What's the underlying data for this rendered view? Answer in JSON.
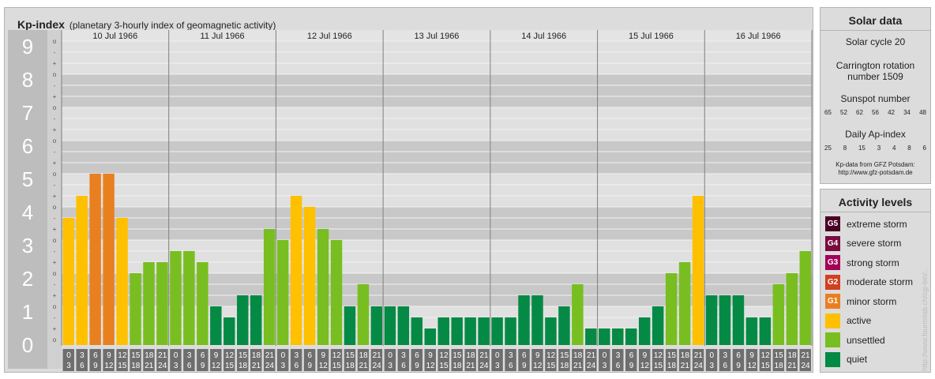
{
  "header": {
    "title": "Kp-index",
    "subtitle": "(planetary 3-hourly index of geomagnetic activity)"
  },
  "chart_data": {
    "type": "bar",
    "title": "Kp-index",
    "subtitle": "(planetary 3-hourly index of geomagnetic activity)",
    "ylim": [
      0,
      9
    ],
    "y_ticks": [
      "0",
      "1",
      "2",
      "3",
      "4",
      "5",
      "6",
      "7",
      "8",
      "9"
    ],
    "y_minor_labels": [
      "o",
      "+",
      "-"
    ],
    "days": [
      "10 Jul 1966",
      "11 Jul 1966",
      "12 Jul 1966",
      "13 Jul 1966",
      "14 Jul 1966",
      "15 Jul 1966",
      "16 Jul 1966"
    ],
    "interval_labels": [
      [
        "0",
        "3"
      ],
      [
        "3",
        "6"
      ],
      [
        "6",
        "9"
      ],
      [
        "9",
        "12"
      ],
      [
        "12",
        "15"
      ],
      [
        "15",
        "18"
      ],
      [
        "18",
        "21"
      ],
      [
        "21",
        "24"
      ]
    ],
    "grid": true,
    "values": [
      3.667,
      4.333,
      5.0,
      5.0,
      3.667,
      2.0,
      2.333,
      2.333,
      2.667,
      2.667,
      2.333,
      1.0,
      0.667,
      1.333,
      1.333,
      3.333,
      3.0,
      4.333,
      4.0,
      3.333,
      3.0,
      1.0,
      1.667,
      1.0,
      1.0,
      1.0,
      0.667,
      0.333,
      0.667,
      0.667,
      0.667,
      0.667,
      0.667,
      0.667,
      1.333,
      1.333,
      0.667,
      1.0,
      1.667,
      0.333,
      0.333,
      0.333,
      0.333,
      0.667,
      1.0,
      2.0,
      2.333,
      4.333,
      1.333,
      1.333,
      1.333,
      0.667,
      0.667,
      1.667,
      2.0,
      2.667
    ],
    "colors": {
      "quiet": "#058a45",
      "unsettled": "#78be21",
      "active": "#ffc000",
      "minor_storm": "#e88020",
      "moderate_storm": "#d14020",
      "strong_storm": "#a30058",
      "severe_storm": "#7a0a40",
      "extreme_storm": "#4a0022"
    }
  },
  "solar": {
    "title": "Solar data",
    "cycle": "Solar cycle 20",
    "carrington_line1": "Carrington rotation",
    "carrington_line2": "number 1509",
    "sunspot_title": "Sunspot number",
    "sunspot_values": [
      "65",
      "52",
      "62",
      "56",
      "42",
      "34",
      "48"
    ],
    "ap_title": "Daily Ap-index",
    "ap_values": [
      "25",
      "8",
      "15",
      "3",
      "4",
      "8",
      "6"
    ],
    "credit_line1": "Kp-data from GFZ Potsdam:",
    "credit_line2": "http://www.gfz-potsdam.de"
  },
  "legend": {
    "title": "Activity levels",
    "items": [
      {
        "badge": "G5",
        "label": "extreme storm",
        "color": "#4a0022"
      },
      {
        "badge": "G4",
        "label": "severe storm",
        "color": "#7a0a40"
      },
      {
        "badge": "G3",
        "label": "strong storm",
        "color": "#a30058"
      },
      {
        "badge": "G2",
        "label": "moderate storm",
        "color": "#d14020"
      },
      {
        "badge": "G1",
        "label": "minor storm",
        "color": "#e88020"
      },
      {
        "badge": "",
        "label": "active",
        "color": "#ffc000"
      },
      {
        "badge": "",
        "label": "unsettled",
        "color": "#78be21"
      },
      {
        "badge": "",
        "label": "quiet",
        "color": "#058a45"
      }
    ]
  },
  "watermark": "http://www.fourmilab.ch/cgi-bin/..."
}
